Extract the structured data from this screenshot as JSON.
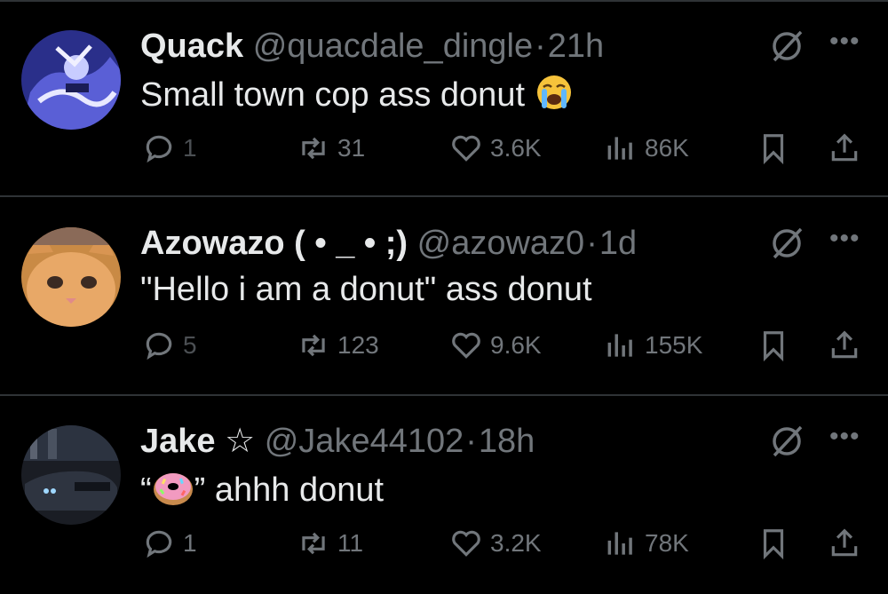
{
  "tweets": [
    {
      "name": "Quack",
      "handle": "@quacdale_dingle",
      "sep": "·",
      "time": "21h",
      "text": "Small town cop ass donut",
      "replies": "1",
      "retweets": "31",
      "likes": "3.6K",
      "views": "86K",
      "emoji": "loudly-crying-face"
    },
    {
      "name": "Azowazo ( • _ • ;)",
      "handle": "@azowaz0",
      "sep": "·",
      "time": "1d",
      "text": "\"Hello i am a donut\" ass donut",
      "replies": "5",
      "retweets": "123",
      "likes": "9.6K",
      "views": "155K"
    },
    {
      "name": "Jake ☆",
      "handle": "@Jake44102",
      "sep": "·",
      "time": "18h",
      "text_prefix": "“",
      "text_suffix": "” ahhh donut",
      "emoji": "doughnut",
      "replies": "1",
      "retweets": "11",
      "likes": "3.2K",
      "views": "78K"
    }
  ],
  "colors": {
    "background": "#000000",
    "text": "#e7e9ea",
    "muted": "#71767b",
    "divider": "#2f3336"
  }
}
